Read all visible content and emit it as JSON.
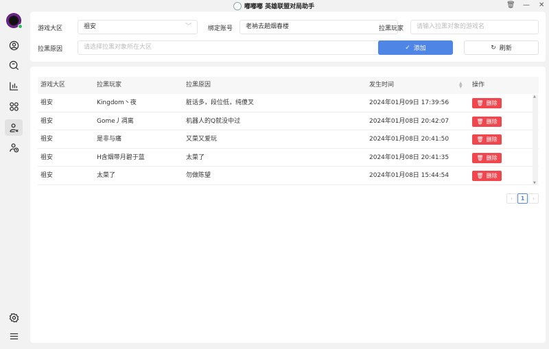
{
  "window": {
    "title": "嘟嘟嘟 英雄联盟对局助手"
  },
  "sidebar": {
    "items": [
      {
        "icon": "user-circle-icon"
      },
      {
        "icon": "search-icon"
      },
      {
        "icon": "chart-icon"
      },
      {
        "icon": "apps-icon"
      },
      {
        "icon": "user-block-icon",
        "active": true
      },
      {
        "icon": "user-history-icon"
      }
    ],
    "bottom": [
      {
        "icon": "gear-icon"
      },
      {
        "icon": "menu-icon"
      }
    ]
  },
  "form": {
    "region_label": "游戏大区",
    "region_value": "祖安",
    "account_label": "绑定账号",
    "account_value": "老衲去趟烟春楼",
    "player_label": "拉黑玩家",
    "player_placeholder": "请输入拉黑对象的游戏名",
    "reason_label": "拉黑原因",
    "reason_placeholder": "请选择拉黑对象所在大区",
    "add_label": "添加",
    "refresh_label": "刷新"
  },
  "table": {
    "headers": [
      "游戏大区",
      "拉黑玩家",
      "拉黑原因",
      "发生时间",
      "操作"
    ],
    "delete_label": "删除",
    "rows": [
      {
        "region": "祖安",
        "player": "Kingdom丶夜",
        "reason": "脏话多，段位低，纯傻叉",
        "time": "2024年01月09日 17:39:56"
      },
      {
        "region": "祖安",
        "player": "Gome丿凋离",
        "reason": "机器人的Q就没中过",
        "time": "2024年01月08日 20:42:07"
      },
      {
        "region": "祖安",
        "player": "是非与痛",
        "reason": "又菜又爱玩",
        "time": "2024年01月08日 20:41:50"
      },
      {
        "region": "祖安",
        "player": "H含烟带月碧于蓝",
        "reason": "太菜了",
        "time": "2024年01月08日 20:41:35"
      },
      {
        "region": "祖安",
        "player": "太菜了",
        "reason": "勿做陈望",
        "time": "2024年01月08日 15:44:54"
      }
    ]
  },
  "pagination": {
    "current": "1"
  },
  "colors": {
    "accent": "#4f86e6",
    "danger": "#f0474f",
    "online": "#2dbf5a"
  }
}
